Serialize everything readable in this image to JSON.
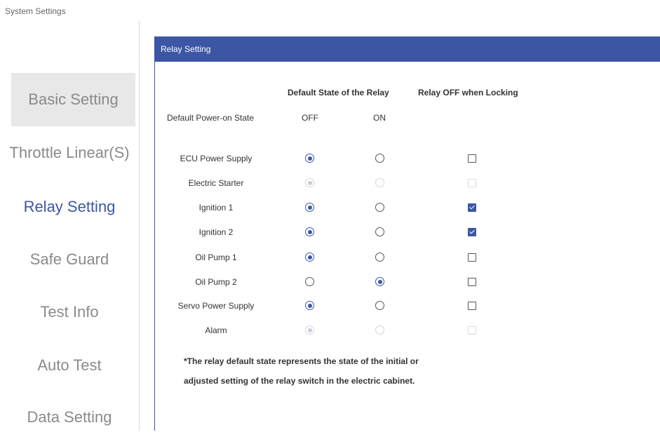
{
  "app_title": "System Settings",
  "sidebar": {
    "items": [
      {
        "label": "Basic Setting"
      },
      {
        "label": "Throttle Linear(S)"
      },
      {
        "label": "Relay Setting"
      },
      {
        "label": "Safe Guard"
      },
      {
        "label": "Test Info"
      },
      {
        "label": "Auto Test"
      },
      {
        "label": "Data Setting"
      }
    ]
  },
  "panel": {
    "title": "Relay Setting",
    "col_default_state": "Default State of the Relay",
    "col_relay_off": "Relay OFF when Locking",
    "power_on_label": "Default Power-on State",
    "off_label": "OFF",
    "on_label": "ON",
    "rows": [
      {
        "label": "ECU Power Supply",
        "state": "OFF",
        "disabled": false,
        "lock_off": false
      },
      {
        "label": "Electric Starter",
        "state": "OFF",
        "disabled": true,
        "lock_off": false
      },
      {
        "label": "Ignition 1",
        "state": "OFF",
        "disabled": false,
        "lock_off": true
      },
      {
        "label": "Ignition 2",
        "state": "OFF",
        "disabled": false,
        "lock_off": true
      },
      {
        "label": "Oil Pump 1",
        "state": "OFF",
        "disabled": false,
        "lock_off": false
      },
      {
        "label": "Oil Pump 2",
        "state": "ON",
        "disabled": false,
        "lock_off": false
      },
      {
        "label": "Servo Power Supply",
        "state": "OFF",
        "disabled": false,
        "lock_off": false
      },
      {
        "label": "Alarm",
        "state": "OFF",
        "disabled": true,
        "lock_off": false
      }
    ],
    "note_line1": "*The relay default state represents the state of the initial or",
    "note_line2": "adjusted setting of the relay switch in the electric cabinet."
  },
  "colors": {
    "accent": "#3c56a5",
    "selected_bg": "#e8e8e8"
  }
}
